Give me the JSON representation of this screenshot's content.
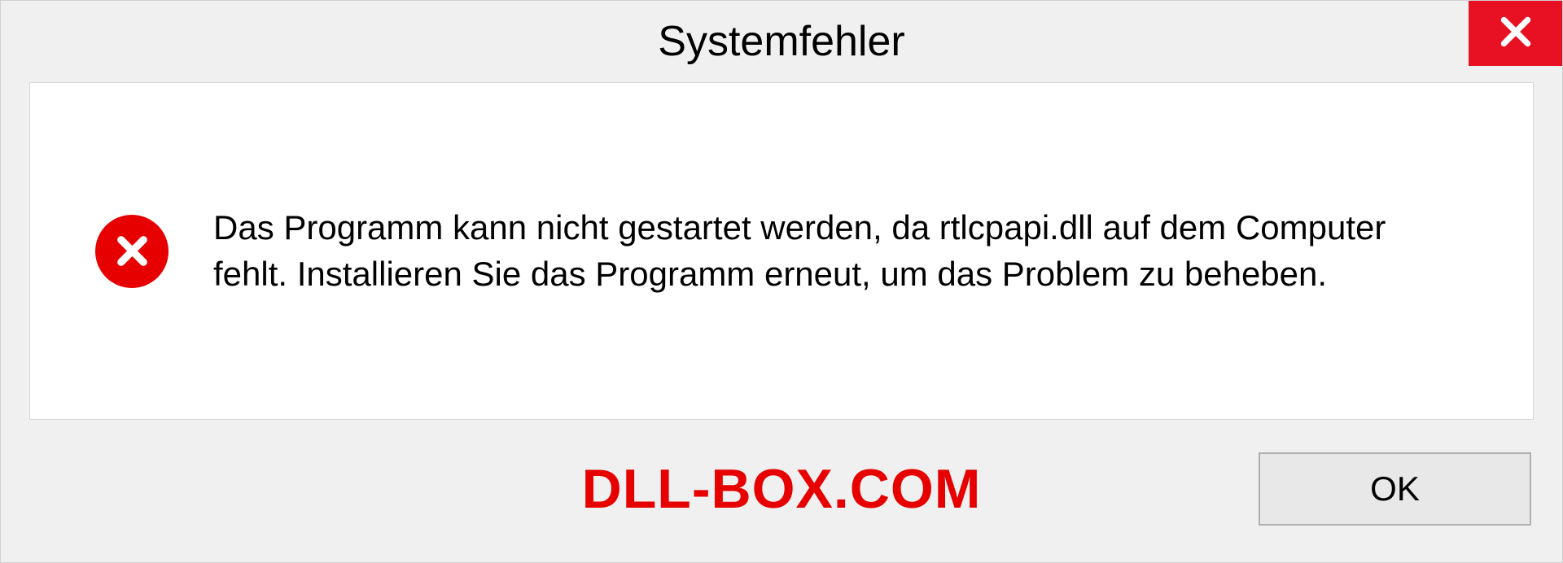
{
  "dialog": {
    "title": "Systemfehler",
    "message": "Das Programm kann nicht gestartet werden, da rtlcpapi.dll auf dem Computer fehlt. Installieren Sie das Programm erneut, um das Problem zu beheben.",
    "ok_label": "OK"
  },
  "watermark": "DLL-BOX.COM",
  "colors": {
    "close_button": "#e81123",
    "error_icon": "#e60000",
    "watermark": "#e60000"
  }
}
